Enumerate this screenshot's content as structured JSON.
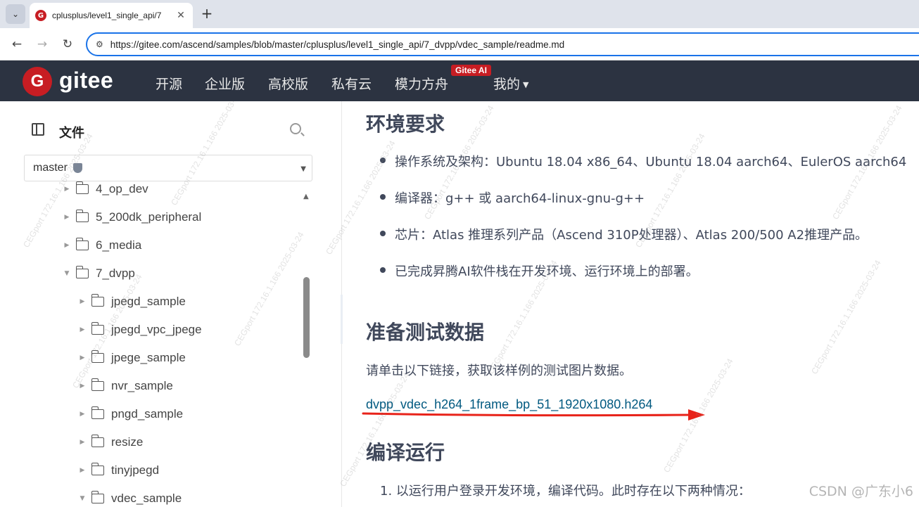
{
  "browser": {
    "tab_title": "cplusplus/level1_single_api/7",
    "tab_favicon": "G",
    "tab_close": "✕",
    "new_tab": "+",
    "url": "https://gitee.com/ascend/samples/blob/master/cplusplus/level1_single_api/7_dvpp/vdec_sample/readme.md",
    "icons": [
      "tab-menu-icon",
      "back-icon",
      "forward-icon",
      "reload-icon",
      "site-info-icon"
    ]
  },
  "header": {
    "logo_mark": "G",
    "logo_text": "gitee",
    "nav": [
      "开源",
      "企业版",
      "高校版",
      "私有云",
      "模力方舟",
      "我的"
    ],
    "ai_badge": "Gitee AI",
    "colors": {
      "header_bg": "#2c3341",
      "brand": "#c71d23"
    }
  },
  "sidebar": {
    "title": "文件",
    "branch": "master",
    "tree": [
      {
        "label": "4_op_dev",
        "state": "collapsed",
        "level": 1
      },
      {
        "label": "5_200dk_peripheral",
        "state": "collapsed",
        "level": 1
      },
      {
        "label": "6_media",
        "state": "collapsed",
        "level": 1
      },
      {
        "label": "7_dvpp",
        "state": "expanded",
        "level": 1
      },
      {
        "label": "jpegd_sample",
        "state": "collapsed",
        "level": 2
      },
      {
        "label": "jpegd_vpc_jpege",
        "state": "collapsed",
        "level": 2
      },
      {
        "label": "jpege_sample",
        "state": "collapsed",
        "level": 2
      },
      {
        "label": "nvr_sample",
        "state": "collapsed",
        "level": 2
      },
      {
        "label": "pngd_sample",
        "state": "collapsed",
        "level": 2
      },
      {
        "label": "resize",
        "state": "collapsed",
        "level": 2
      },
      {
        "label": "tinyjpegd",
        "state": "collapsed",
        "level": 2
      },
      {
        "label": "vdec_sample",
        "state": "expanded",
        "level": 2
      }
    ]
  },
  "content": {
    "env_heading": "环境要求",
    "env_items": [
      "操作系统及架构：Ubuntu 18.04 x86_64、Ubuntu 18.04 aarch64、EulerOS aarch64",
      "编译器：g++ 或 aarch64-linux-gnu-g++",
      "芯片：Atlas 推理系列产品（Ascend 310P处理器）、Atlas 200/500 A2推理产品。",
      "已完成昇腾AI软件栈在开发环境、运行环境上的部署。"
    ],
    "data_heading": "准备测试数据",
    "data_para": "请单击以下链接，获取该样例的测试图片数据。",
    "data_link": "dvpp_vdec_h264_1frame_bp_51_1920x1080.h264",
    "build_heading": "编译运行",
    "build_step_1": "1. 以运行用户登录开发环境，编译代码。此时存在以下两种情况：",
    "annotation_color": "#e8231a",
    "link_color": "#005980"
  },
  "watermark": {
    "text": "CEGport 172.16.1.166 2025-03-24",
    "csdn": "CSDN @广东小6"
  }
}
